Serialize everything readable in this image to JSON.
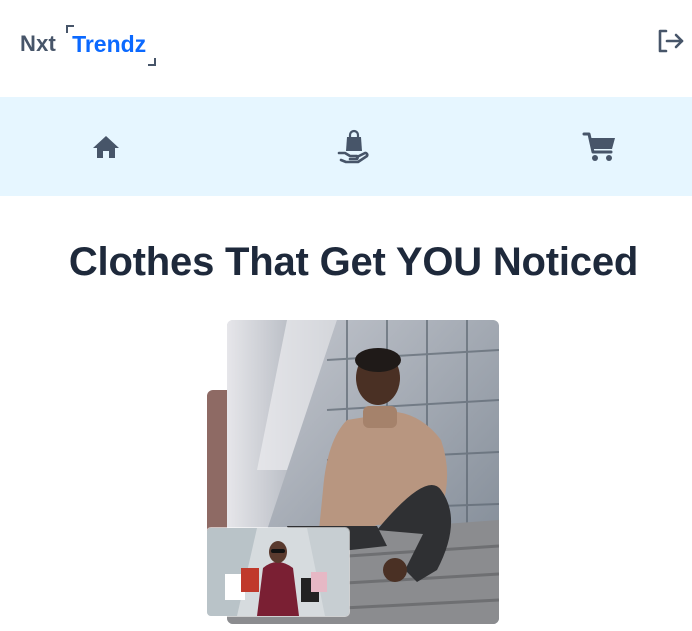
{
  "header": {
    "logo": {
      "primary": "Nxt",
      "secondary": "Trendz"
    },
    "logout_icon": "logout-icon"
  },
  "nav": {
    "items": [
      {
        "id": "home",
        "icon": "home-icon"
      },
      {
        "id": "products",
        "icon": "shopping-bag-hand-icon"
      },
      {
        "id": "cart",
        "icon": "cart-icon"
      }
    ]
  },
  "main": {
    "title": "Clothes That Get YOU Noticed",
    "hero_images": [
      "man-sitting-on-steps-photo",
      "woman-with-shopping-bags-photo"
    ]
  },
  "colors": {
    "brand_blue": "#0b69ff",
    "text_dark": "#1e293b",
    "icon_slate": "#475569",
    "nav_bg": "#e6f6ff"
  }
}
